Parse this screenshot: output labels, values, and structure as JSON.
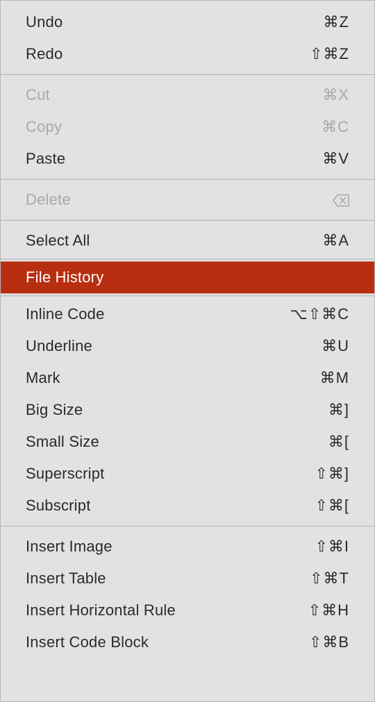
{
  "menu": {
    "groups": [
      [
        {
          "id": "undo",
          "label": "Undo",
          "shortcut": "⌘Z",
          "disabled": false
        },
        {
          "id": "redo",
          "label": "Redo",
          "shortcut": "⇧⌘Z",
          "disabled": false
        }
      ],
      [
        {
          "id": "cut",
          "label": "Cut",
          "shortcut": "⌘X",
          "disabled": true
        },
        {
          "id": "copy",
          "label": "Copy",
          "shortcut": "⌘C",
          "disabled": true
        },
        {
          "id": "paste",
          "label": "Paste",
          "shortcut": "⌘V",
          "disabled": false
        }
      ],
      [
        {
          "id": "delete",
          "label": "Delete",
          "shortcut_icon": "backspace",
          "disabled": true
        }
      ],
      [
        {
          "id": "select-all",
          "label": "Select All",
          "shortcut": "⌘A",
          "disabled": false
        }
      ],
      [
        {
          "id": "file-history",
          "label": "File History",
          "shortcut": "",
          "disabled": false,
          "highlighted": true
        }
      ],
      [
        {
          "id": "inline-code",
          "label": "Inline Code",
          "shortcut": "⌥⇧⌘C",
          "disabled": false
        },
        {
          "id": "underline",
          "label": "Underline",
          "shortcut": "⌘U",
          "disabled": false
        },
        {
          "id": "mark",
          "label": "Mark",
          "shortcut": "⌘M",
          "disabled": false
        },
        {
          "id": "big-size",
          "label": "Big Size",
          "shortcut": "⌘]",
          "disabled": false
        },
        {
          "id": "small-size",
          "label": "Small Size",
          "shortcut": "⌘[",
          "disabled": false
        },
        {
          "id": "superscript",
          "label": "Superscript",
          "shortcut": "⇧⌘]",
          "disabled": false
        },
        {
          "id": "subscript",
          "label": "Subscript",
          "shortcut": "⇧⌘[",
          "disabled": false
        }
      ],
      [
        {
          "id": "insert-image",
          "label": "Insert Image",
          "shortcut": "⇧⌘I",
          "disabled": false
        },
        {
          "id": "insert-table",
          "label": "Insert Table",
          "shortcut": "⇧⌘T",
          "disabled": false
        },
        {
          "id": "insert-horizontal-rule",
          "label": "Insert Horizontal Rule",
          "shortcut": "⇧⌘H",
          "disabled": false
        },
        {
          "id": "insert-code-block",
          "label": "Insert Code Block",
          "shortcut": "⇧⌘B",
          "disabled": false
        }
      ]
    ]
  }
}
